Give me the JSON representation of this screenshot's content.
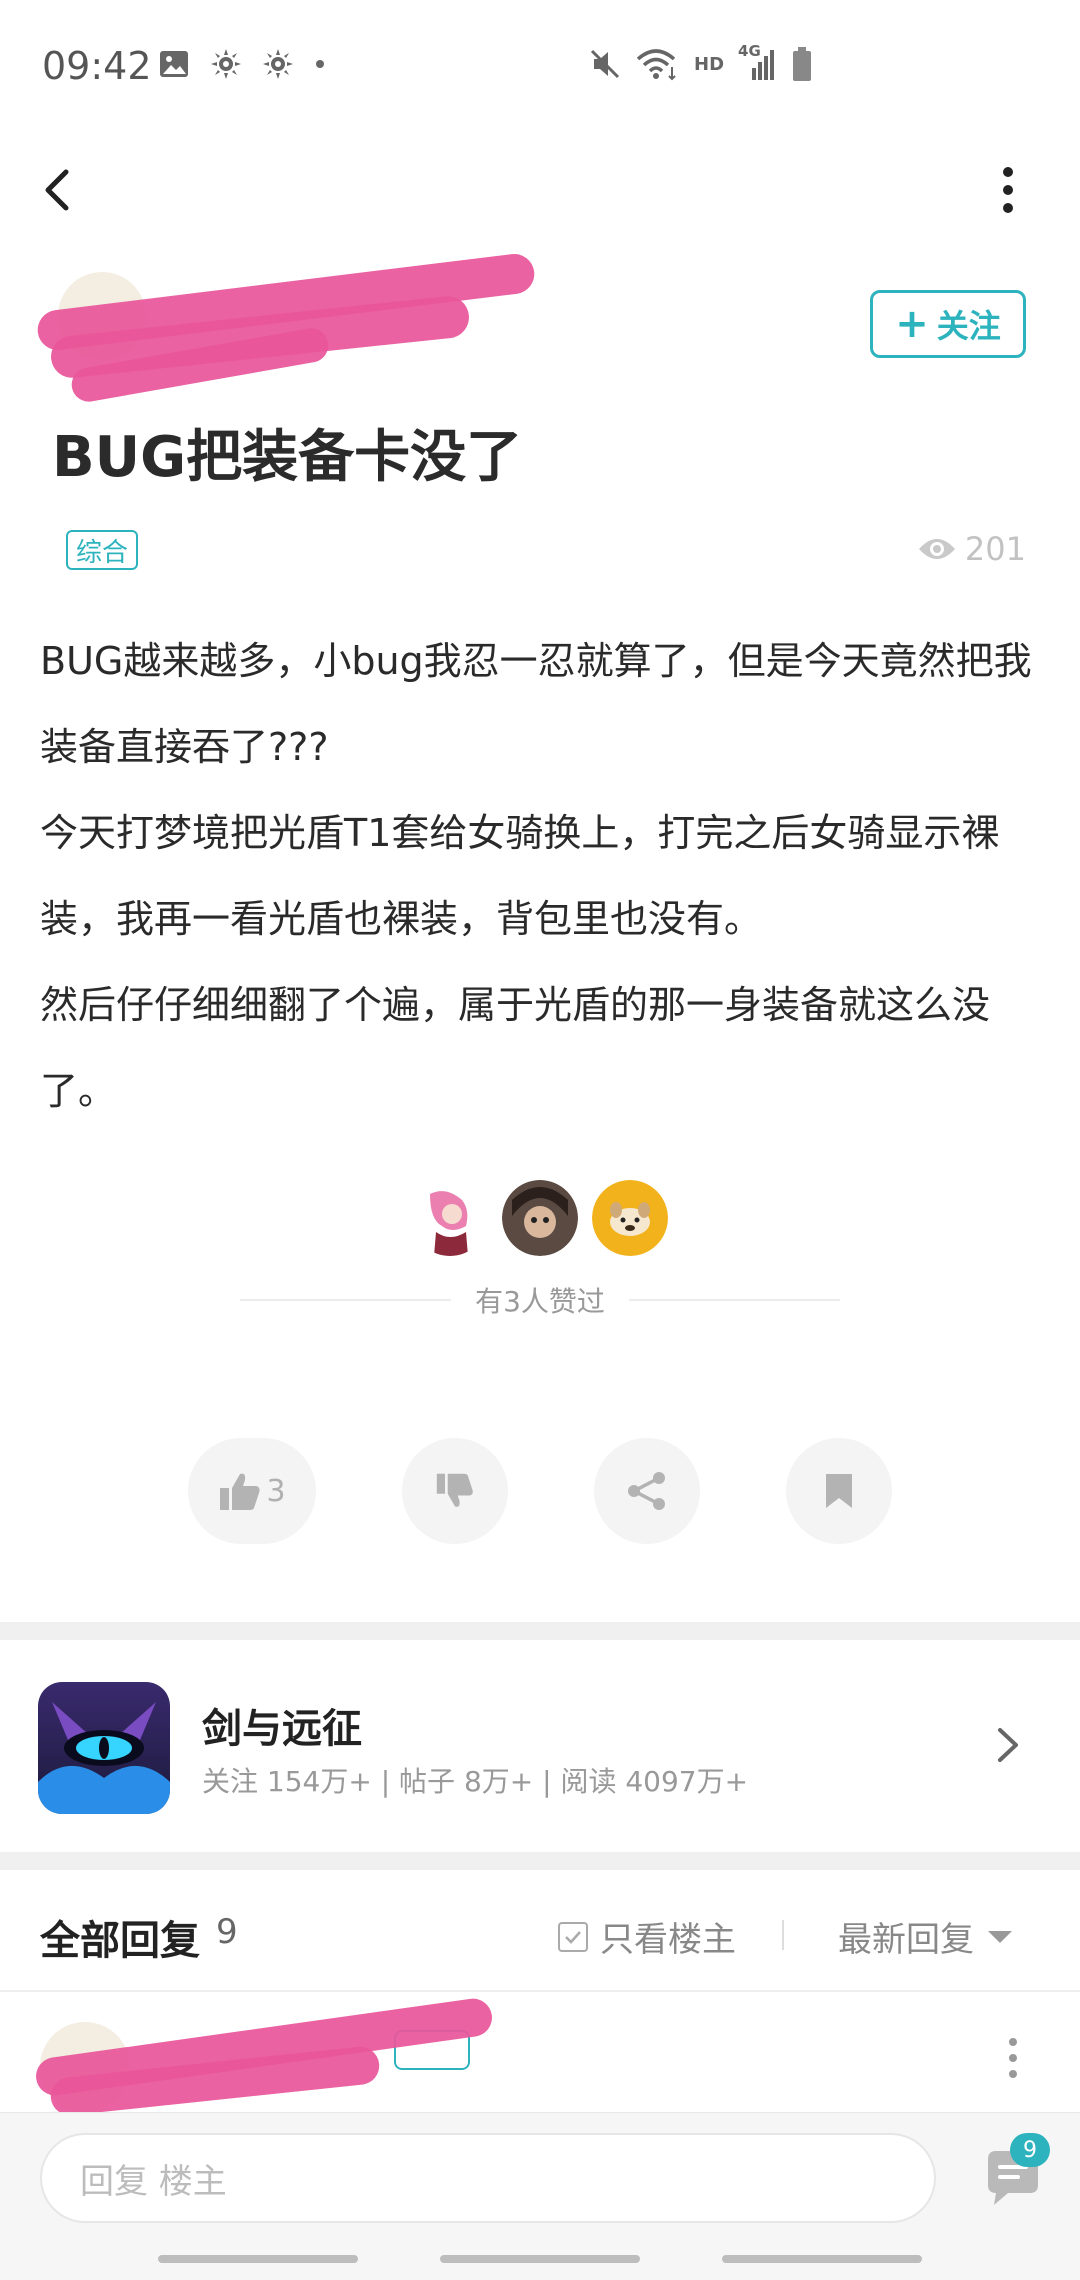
{
  "status_bar": {
    "time": "09:42",
    "left_icons": [
      "image-icon",
      "sun-icon",
      "sun-icon",
      "dot-icon"
    ],
    "right_icons": [
      "mute-icon",
      "wifi-icon",
      "hd-icon",
      "signal-4g-icon",
      "battery-icon"
    ],
    "hd_label": "HD",
    "network_label": "4G"
  },
  "header": {
    "follow_label": "关注"
  },
  "post": {
    "title": "BUG把装备卡没了",
    "tag": "综合",
    "views": "201",
    "paragraphs": [
      "BUG越来越多，小bug我忍一忍就算了，但是今天竟然把我装备直接吞了???",
      "今天打梦境把光盾T1套给女骑换上，打完之后女骑显示裸装，我再一看光盾也裸装，背包里也没有。",
      "然后仔仔细细翻了个遍，属于光盾的那一身装备就这么没了。"
    ],
    "liked_text": "有3人赞过",
    "like_count": "3"
  },
  "game": {
    "name": "剑与远征",
    "stats": "关注 154万+ | 帖子 8万+ | 阅读 4097万+"
  },
  "replies": {
    "title": "全部回复",
    "count": "9",
    "only_host": "只看楼主",
    "sort": "最新回复"
  },
  "bottom": {
    "input_placeholder": "回复  楼主",
    "badge": "9"
  },
  "colors": {
    "accent": "#2db3bd",
    "redaction": "#e8569a"
  }
}
